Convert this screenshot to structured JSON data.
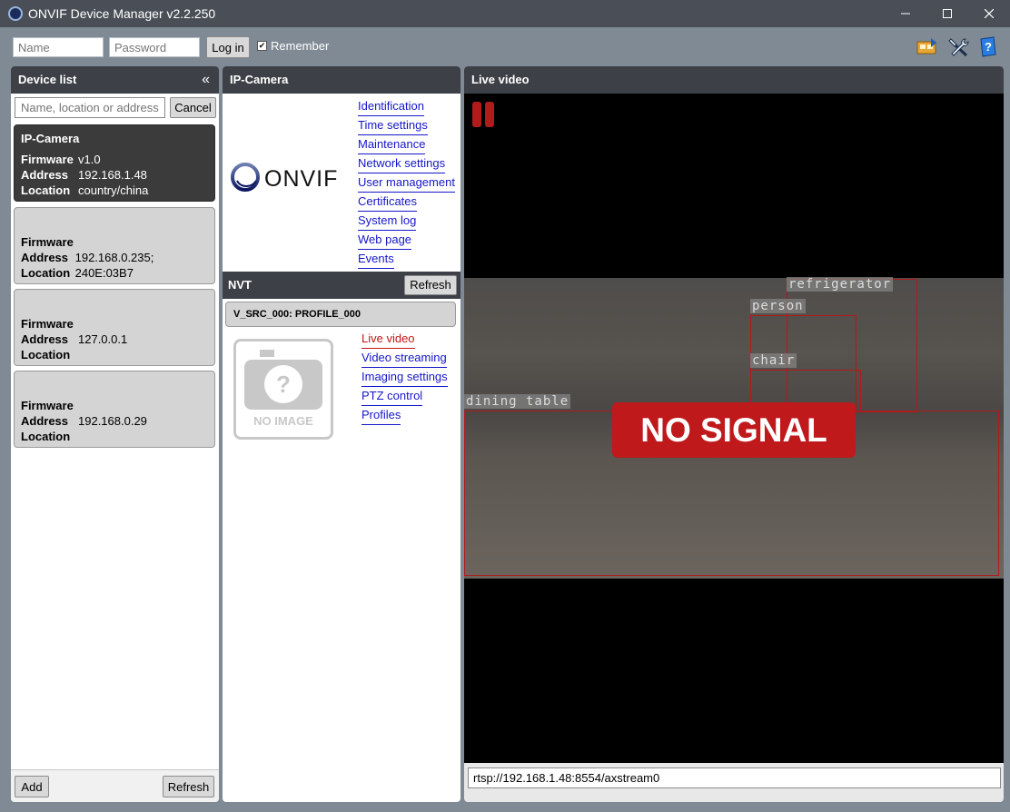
{
  "window": {
    "title": "ONVIF Device Manager v2.2.250"
  },
  "login": {
    "name_placeholder": "Name",
    "password_placeholder": "Password",
    "login_label": "Log in",
    "remember_label": "Remember"
  },
  "device_list": {
    "title": "Device list",
    "search_placeholder": "Name, location or address",
    "cancel_label": "Cancel",
    "devices": [
      {
        "name": "IP-Camera",
        "firmware_label": "Firmware",
        "firmware": "v1.0",
        "address_label": "Address",
        "address": "192.168.1.48",
        "location_label": "Location",
        "location": "country/china"
      },
      {
        "name": "",
        "firmware_label": "Firmware",
        "firmware": "",
        "address_label": "Address",
        "address": "192.168.0.235; 240E:03B7",
        "location_label": "Location",
        "location": ""
      },
      {
        "name": "",
        "firmware_label": "Firmware",
        "firmware": "",
        "address_label": "Address",
        "address": "127.0.0.1",
        "location_label": "Location",
        "location": ""
      },
      {
        "name": "",
        "firmware_label": "Firmware",
        "firmware": "",
        "address_label": "Address",
        "address": "192.168.0.29",
        "location_label": "Location",
        "location": ""
      }
    ],
    "add_label": "Add",
    "refresh_label": "Refresh"
  },
  "camera": {
    "title": "IP-Camera",
    "logo_text": "ONVIF",
    "links": [
      "Identification",
      "Time settings",
      "Maintenance",
      "Network settings",
      "User management",
      "Certificates",
      "System log",
      "Web page",
      "Events"
    ],
    "nvt_title": "NVT",
    "refresh_label": "Refresh",
    "profile": "V_SRC_000: PROFILE_000",
    "no_image_text": "NO IMAGE",
    "profile_links": [
      "Live video",
      "Video streaming",
      "Imaging settings",
      "PTZ control",
      "Profiles"
    ]
  },
  "live": {
    "title": "Live video",
    "no_signal": "NO SIGNAL",
    "detections": [
      "refrigerator",
      "person",
      "chair",
      "dining table"
    ],
    "url": "rtsp://192.168.1.48:8554/axstream0"
  },
  "colors": {
    "link": "#1515c9",
    "active_link": "#c71515",
    "no_signal_bg": "#c0191c",
    "detection_box": "#b11a1a",
    "panel_header": "#3d4046"
  },
  "icons": [
    "minimize-icon",
    "maximize-icon",
    "close-icon",
    "network-card-icon",
    "tools-icon",
    "help-icon",
    "collapse-icon",
    "pause-icon",
    "camera-icon"
  ]
}
